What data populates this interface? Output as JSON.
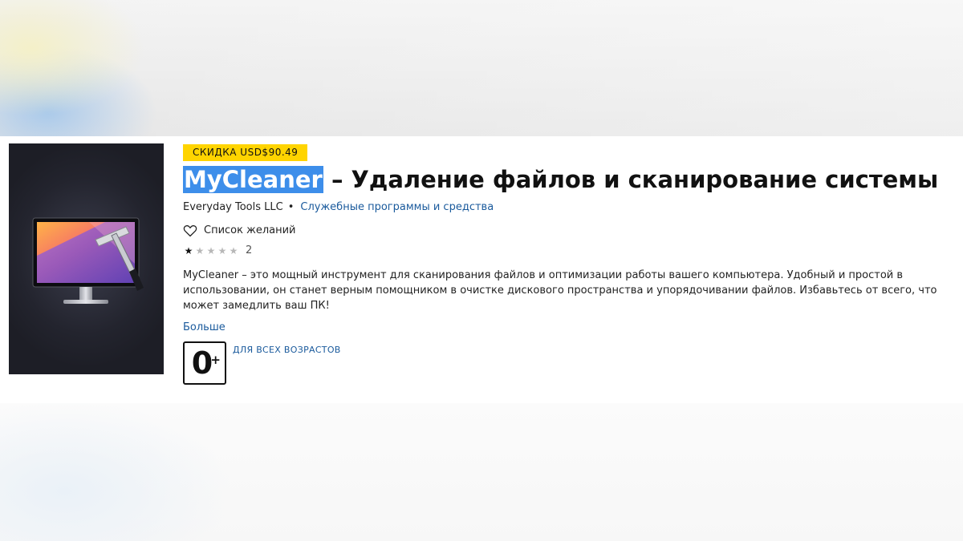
{
  "colors": {
    "badge_bg": "#ffd400",
    "title_highlight": "#3d8eea",
    "link": "#1a5a9c"
  },
  "product": {
    "discount_badge": "СКИДКА USD$90.49",
    "title_highlighted": "MyCleaner",
    "title_rest": " – Удаление файлов и сканирование системы",
    "publisher": "Everyday Tools LLC",
    "bullet": "•",
    "category": "Служебные программы и средства",
    "wishlist_label": "Список желаний",
    "wishlist_icon": "heart-outline-icon",
    "rating": {
      "stars_filled": 1,
      "stars_total": 5,
      "count": "2"
    },
    "description": "MyCleaner – это мощный инструмент для сканирования файлов и оптимизации работы вашего компьютера. Удобный и простой в использовании, он станет верным помощником в очистке дискового пространства и упорядочивании файлов. Избавьтесь от всего, что может замедлить ваш ПК!",
    "more_label": "Больше",
    "age_rating": {
      "number": "0",
      "plus": "+",
      "label": "ДЛЯ ВСЕХ ВОЗРАСТОВ"
    },
    "image_icon": "monitor-squeegee-icon"
  }
}
